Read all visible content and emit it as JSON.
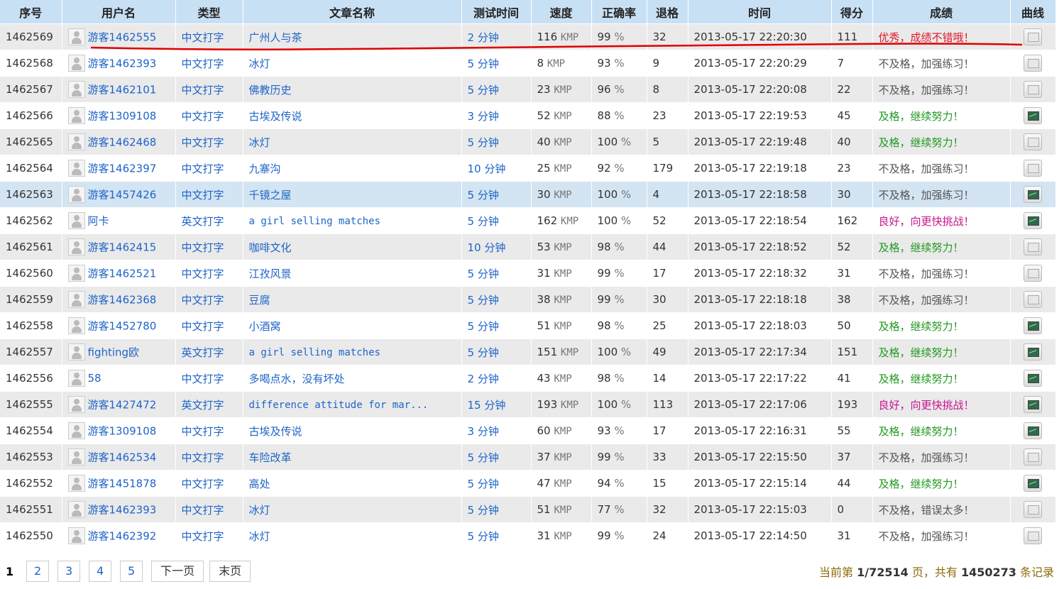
{
  "headers": {
    "id": "序号",
    "user": "用户名",
    "type": "类型",
    "article": "文章名称",
    "duration": "测试时间",
    "speed": "速度",
    "accuracy": "正确率",
    "backspace": "退格",
    "time": "时间",
    "score": "得分",
    "result": "成绩",
    "chart": "曲线"
  },
  "units": {
    "speed": "KMP",
    "accuracy": "%",
    "duration": "分钟"
  },
  "rows": [
    {
      "id": "1462569",
      "user": "游客1462555",
      "type": "中文打字",
      "article": "广州人与茶",
      "mins": "2",
      "speed": "116",
      "acc": "99",
      "bs": "32",
      "time": "2013-05-17 22:20:30",
      "score": "111",
      "result": "优秀，成绩不错哦！",
      "level": "excellent",
      "chart": false
    },
    {
      "id": "1462568",
      "user": "游客1462393",
      "type": "中文打字",
      "article": "冰灯",
      "mins": "5",
      "speed": "8",
      "acc": "93",
      "bs": "9",
      "time": "2013-05-17 22:20:29",
      "score": "7",
      "result": "不及格，加强练习！",
      "level": "fail",
      "chart": false
    },
    {
      "id": "1462567",
      "user": "游客1462101",
      "type": "中文打字",
      "article": "佛教历史",
      "mins": "5",
      "speed": "23",
      "acc": "96",
      "bs": "8",
      "time": "2013-05-17 22:20:08",
      "score": "22",
      "result": "不及格，加强练习！",
      "level": "fail",
      "chart": false
    },
    {
      "id": "1462566",
      "user": "游客1309108",
      "type": "中文打字",
      "article": "古埃及传说",
      "mins": "3",
      "speed": "52",
      "acc": "88",
      "bs": "23",
      "time": "2013-05-17 22:19:53",
      "score": "45",
      "result": "及格，继续努力！",
      "level": "pass",
      "chart": true
    },
    {
      "id": "1462565",
      "user": "游客1462468",
      "type": "中文打字",
      "article": "冰灯",
      "mins": "5",
      "speed": "40",
      "acc": "100",
      "bs": "5",
      "time": "2013-05-17 22:19:48",
      "score": "40",
      "result": "及格，继续努力！",
      "level": "pass",
      "chart": false
    },
    {
      "id": "1462564",
      "user": "游客1462397",
      "type": "中文打字",
      "article": "九寨沟",
      "mins": "10",
      "speed": "25",
      "acc": "92",
      "bs": "179",
      "time": "2013-05-17 22:19:18",
      "score": "23",
      "result": "不及格，加强练习！",
      "level": "fail",
      "chart": false
    },
    {
      "id": "1462563",
      "user": "游客1457426",
      "type": "中文打字",
      "article": "千镜之屋",
      "mins": "5",
      "speed": "30",
      "acc": "100",
      "bs": "4",
      "time": "2013-05-17 22:18:58",
      "score": "30",
      "result": "不及格，加强练习！",
      "level": "fail",
      "chart": true
    },
    {
      "id": "1462562",
      "user": "阿卡",
      "type": "英文打字",
      "article": "a girl selling matches",
      "mins": "5",
      "speed": "162",
      "acc": "100",
      "bs": "52",
      "time": "2013-05-17 22:18:54",
      "score": "162",
      "result": "良好，向更快挑战！",
      "level": "good",
      "chart": true
    },
    {
      "id": "1462561",
      "user": "游客1462415",
      "type": "中文打字",
      "article": "咖啡文化",
      "mins": "10",
      "speed": "53",
      "acc": "98",
      "bs": "44",
      "time": "2013-05-17 22:18:52",
      "score": "52",
      "result": "及格，继续努力！",
      "level": "pass",
      "chart": false
    },
    {
      "id": "1462560",
      "user": "游客1462521",
      "type": "中文打字",
      "article": "江孜风景",
      "mins": "5",
      "speed": "31",
      "acc": "99",
      "bs": "17",
      "time": "2013-05-17 22:18:32",
      "score": "31",
      "result": "不及格，加强练习！",
      "level": "fail",
      "chart": false
    },
    {
      "id": "1462559",
      "user": "游客1462368",
      "type": "中文打字",
      "article": "豆腐",
      "mins": "5",
      "speed": "38",
      "acc": "99",
      "bs": "30",
      "time": "2013-05-17 22:18:18",
      "score": "38",
      "result": "不及格，加强练习！",
      "level": "fail",
      "chart": false
    },
    {
      "id": "1462558",
      "user": "游客1452780",
      "type": "中文打字",
      "article": "小酒窝",
      "mins": "5",
      "speed": "51",
      "acc": "98",
      "bs": "25",
      "time": "2013-05-17 22:18:03",
      "score": "50",
      "result": "及格，继续努力！",
      "level": "pass",
      "chart": true
    },
    {
      "id": "1462557",
      "user": "fighting欧",
      "type": "英文打字",
      "article": "a girl selling matches",
      "mins": "5",
      "speed": "151",
      "acc": "100",
      "bs": "49",
      "time": "2013-05-17 22:17:34",
      "score": "151",
      "result": "及格，继续努力！",
      "level": "pass",
      "chart": true
    },
    {
      "id": "1462556",
      "user": "58",
      "type": "中文打字",
      "article": "多喝点水，没有坏处",
      "mins": "2",
      "speed": "43",
      "acc": "98",
      "bs": "14",
      "time": "2013-05-17 22:17:22",
      "score": "41",
      "result": "及格，继续努力！",
      "level": "pass",
      "chart": true
    },
    {
      "id": "1462555",
      "user": "游客1427472",
      "type": "英文打字",
      "article": "difference attitude for mar...",
      "mins": "15",
      "speed": "193",
      "acc": "100",
      "bs": "113",
      "time": "2013-05-17 22:17:06",
      "score": "193",
      "result": "良好，向更快挑战！",
      "level": "good",
      "chart": true
    },
    {
      "id": "1462554",
      "user": "游客1309108",
      "type": "中文打字",
      "article": "古埃及传说",
      "mins": "3",
      "speed": "60",
      "acc": "93",
      "bs": "17",
      "time": "2013-05-17 22:16:31",
      "score": "55",
      "result": "及格，继续努力！",
      "level": "pass",
      "chart": true
    },
    {
      "id": "1462553",
      "user": "游客1462534",
      "type": "中文打字",
      "article": "车险改革",
      "mins": "5",
      "speed": "37",
      "acc": "99",
      "bs": "33",
      "time": "2013-05-17 22:15:50",
      "score": "37",
      "result": "不及格，加强练习！",
      "level": "fail",
      "chart": false
    },
    {
      "id": "1462552",
      "user": "游客1451878",
      "type": "中文打字",
      "article": "高处",
      "mins": "5",
      "speed": "47",
      "acc": "94",
      "bs": "15",
      "time": "2013-05-17 22:15:14",
      "score": "44",
      "result": "及格，继续努力！",
      "level": "pass",
      "chart": true
    },
    {
      "id": "1462551",
      "user": "游客1462393",
      "type": "中文打字",
      "article": "冰灯",
      "mins": "5",
      "speed": "51",
      "acc": "77",
      "bs": "32",
      "time": "2013-05-17 22:15:03",
      "score": "0",
      "result": "不及格，错误太多！",
      "level": "fail",
      "chart": false
    },
    {
      "id": "1462550",
      "user": "游客1462392",
      "type": "中文打字",
      "article": "冰灯",
      "mins": "5",
      "speed": "31",
      "acc": "99",
      "bs": "24",
      "time": "2013-05-17 22:14:50",
      "score": "31",
      "result": "不及格，加强练习！",
      "level": "fail",
      "chart": false
    }
  ],
  "pagination": {
    "current": "1",
    "pages": [
      "2",
      "3",
      "4",
      "5"
    ],
    "next": "下一页",
    "last": "末页"
  },
  "summary": {
    "prefix": "当前第",
    "page": "1/72514",
    "middle": "页，共有",
    "total": "1450273",
    "suffix": "条记录"
  },
  "colors": {
    "header_bg": "#c8e0f4",
    "link": "#1e64c8",
    "excellent": "#e0182a",
    "good": "#c8148c",
    "pass": "#229922",
    "fail": "#555555",
    "annotation": "#e00000"
  }
}
